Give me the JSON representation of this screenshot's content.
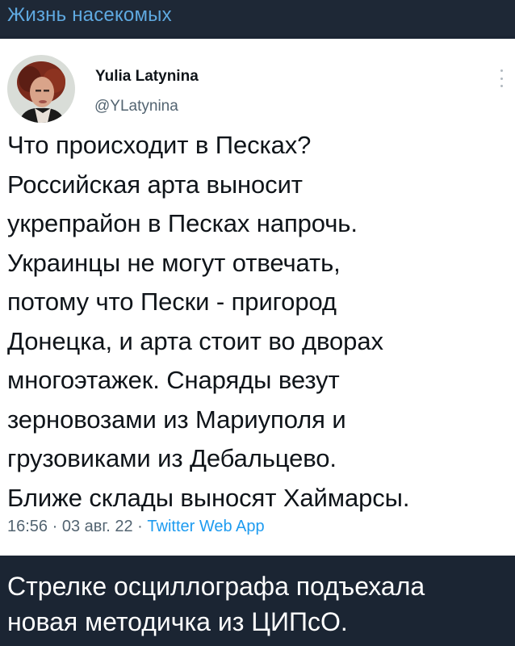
{
  "channel": {
    "title": "Жизнь насекомых"
  },
  "tweet": {
    "author_name": "Yulia Latynina",
    "author_handle": "@YLatynina",
    "lines": [
      "Что происходит в Песках?",
      "Российская арта выносит",
      "укрепрайон в Песках напрочь.",
      "Украинцы не могут отвечать,",
      "потому что Пески - пригород",
      "Донецка, и арта стоит во дворах",
      "многоэтажек. Снаряды везут",
      "зерновозами из Мариуполя и",
      "грузовиками из Дебальцево.",
      "Ближе склады выносят Хаймарсы."
    ],
    "time": "16:56",
    "separator": " · ",
    "date": "03 авг. 22",
    "source": "Twitter Web App",
    "avatar_icon": "person-avatar-icon",
    "more_icon": "more-vertical-icon"
  },
  "caption": {
    "lines": [
      "Стрелке осциллографа подъехала",
      "новая методичка из ЦИПсО."
    ]
  },
  "colors": {
    "background": "#1b2533",
    "channel_title": "#5fa9e0",
    "card": "#ffffff",
    "text": "#0f1419",
    "muted": "#536471",
    "link": "#1d9bf0",
    "caption": "#ffffff"
  }
}
